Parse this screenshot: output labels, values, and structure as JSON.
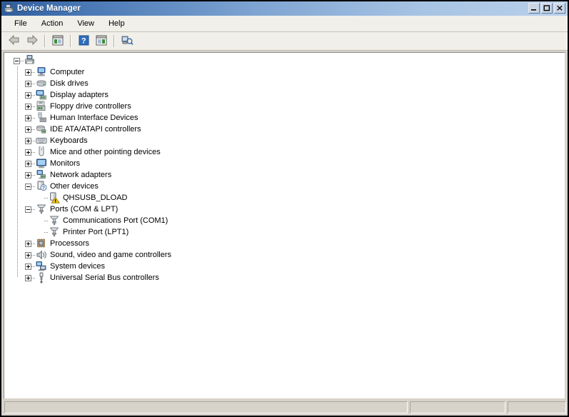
{
  "window": {
    "title": "Device Manager",
    "title_icon": "device-manager-icon",
    "buttons": {
      "minimize": "minimize-button",
      "maximize": "maximize-button",
      "close": "close-button"
    }
  },
  "menubar": {
    "items": [
      {
        "label": "File",
        "name": "menu-file"
      },
      {
        "label": "Action",
        "name": "menu-action"
      },
      {
        "label": "View",
        "name": "menu-view"
      },
      {
        "label": "Help",
        "name": "menu-help"
      }
    ]
  },
  "toolbar": {
    "items": [
      {
        "name": "back-icon",
        "title": "Back"
      },
      {
        "name": "forward-icon",
        "title": "Forward"
      },
      {
        "name": "separator-1",
        "title": ""
      },
      {
        "name": "show-hide-console-tree-icon",
        "title": "Show/Hide Console Tree"
      },
      {
        "name": "separator-2",
        "title": ""
      },
      {
        "name": "help-icon",
        "title": "Help"
      },
      {
        "name": "properties-icon",
        "title": "Properties"
      },
      {
        "name": "separator-3",
        "title": ""
      },
      {
        "name": "scan-for-hardware-changes-icon",
        "title": "Scan for hardware changes"
      }
    ]
  },
  "tree": {
    "root": {
      "label": "",
      "icon": "computer-root-icon",
      "expanded": true
    },
    "nodes": [
      {
        "label": "Computer",
        "icon": "computer-icon",
        "state": "collapsed",
        "level": 1
      },
      {
        "label": "Disk drives",
        "icon": "disk-drive-icon",
        "state": "collapsed",
        "level": 1
      },
      {
        "label": "Display adapters",
        "icon": "display-adapter-icon",
        "state": "collapsed",
        "level": 1
      },
      {
        "label": "Floppy drive controllers",
        "icon": "floppy-controller-icon",
        "state": "collapsed",
        "level": 1
      },
      {
        "label": "Human Interface Devices",
        "icon": "hid-icon",
        "state": "collapsed",
        "level": 1
      },
      {
        "label": "IDE ATA/ATAPI controllers",
        "icon": "ide-controller-icon",
        "state": "collapsed",
        "level": 1
      },
      {
        "label": "Keyboards",
        "icon": "keyboard-icon",
        "state": "collapsed",
        "level": 1
      },
      {
        "label": "Mice and other pointing devices",
        "icon": "mouse-icon",
        "state": "collapsed",
        "level": 1
      },
      {
        "label": "Monitors",
        "icon": "monitor-icon",
        "state": "collapsed",
        "level": 1
      },
      {
        "label": "Network adapters",
        "icon": "network-adapter-icon",
        "state": "collapsed",
        "level": 1
      },
      {
        "label": "Other devices",
        "icon": "unknown-device-icon",
        "state": "expanded",
        "level": 1
      },
      {
        "label": "QHSUSB_DLOAD",
        "icon": "unknown-device-warning-icon",
        "state": "leaf",
        "level": 2,
        "warning": true
      },
      {
        "label": "Ports (COM & LPT)",
        "icon": "port-icon",
        "state": "expanded",
        "level": 1
      },
      {
        "label": "Communications Port (COM1)",
        "icon": "port-icon",
        "state": "leaf",
        "level": 2
      },
      {
        "label": "Printer Port (LPT1)",
        "icon": "port-icon",
        "state": "leaf",
        "level": 2
      },
      {
        "label": "Processors",
        "icon": "processor-icon",
        "state": "collapsed",
        "level": 1
      },
      {
        "label": "Sound, video and game controllers",
        "icon": "sound-controller-icon",
        "state": "collapsed",
        "level": 1
      },
      {
        "label": "System devices",
        "icon": "system-device-icon",
        "state": "collapsed",
        "level": 1
      },
      {
        "label": "Universal Serial Bus controllers",
        "icon": "usb-controller-icon",
        "state": "collapsed",
        "level": 1
      }
    ]
  },
  "statusbar": {
    "pane1": "",
    "pane2": "",
    "pane3": ""
  },
  "colors": {
    "title_gradient_start": "#2f5d9c",
    "title_gradient_end": "#b9d0ea",
    "chrome": "#d7d3cb",
    "toolbar": "#f1efe9",
    "tree_background": "#ffffff",
    "warning": "#f5c518"
  }
}
